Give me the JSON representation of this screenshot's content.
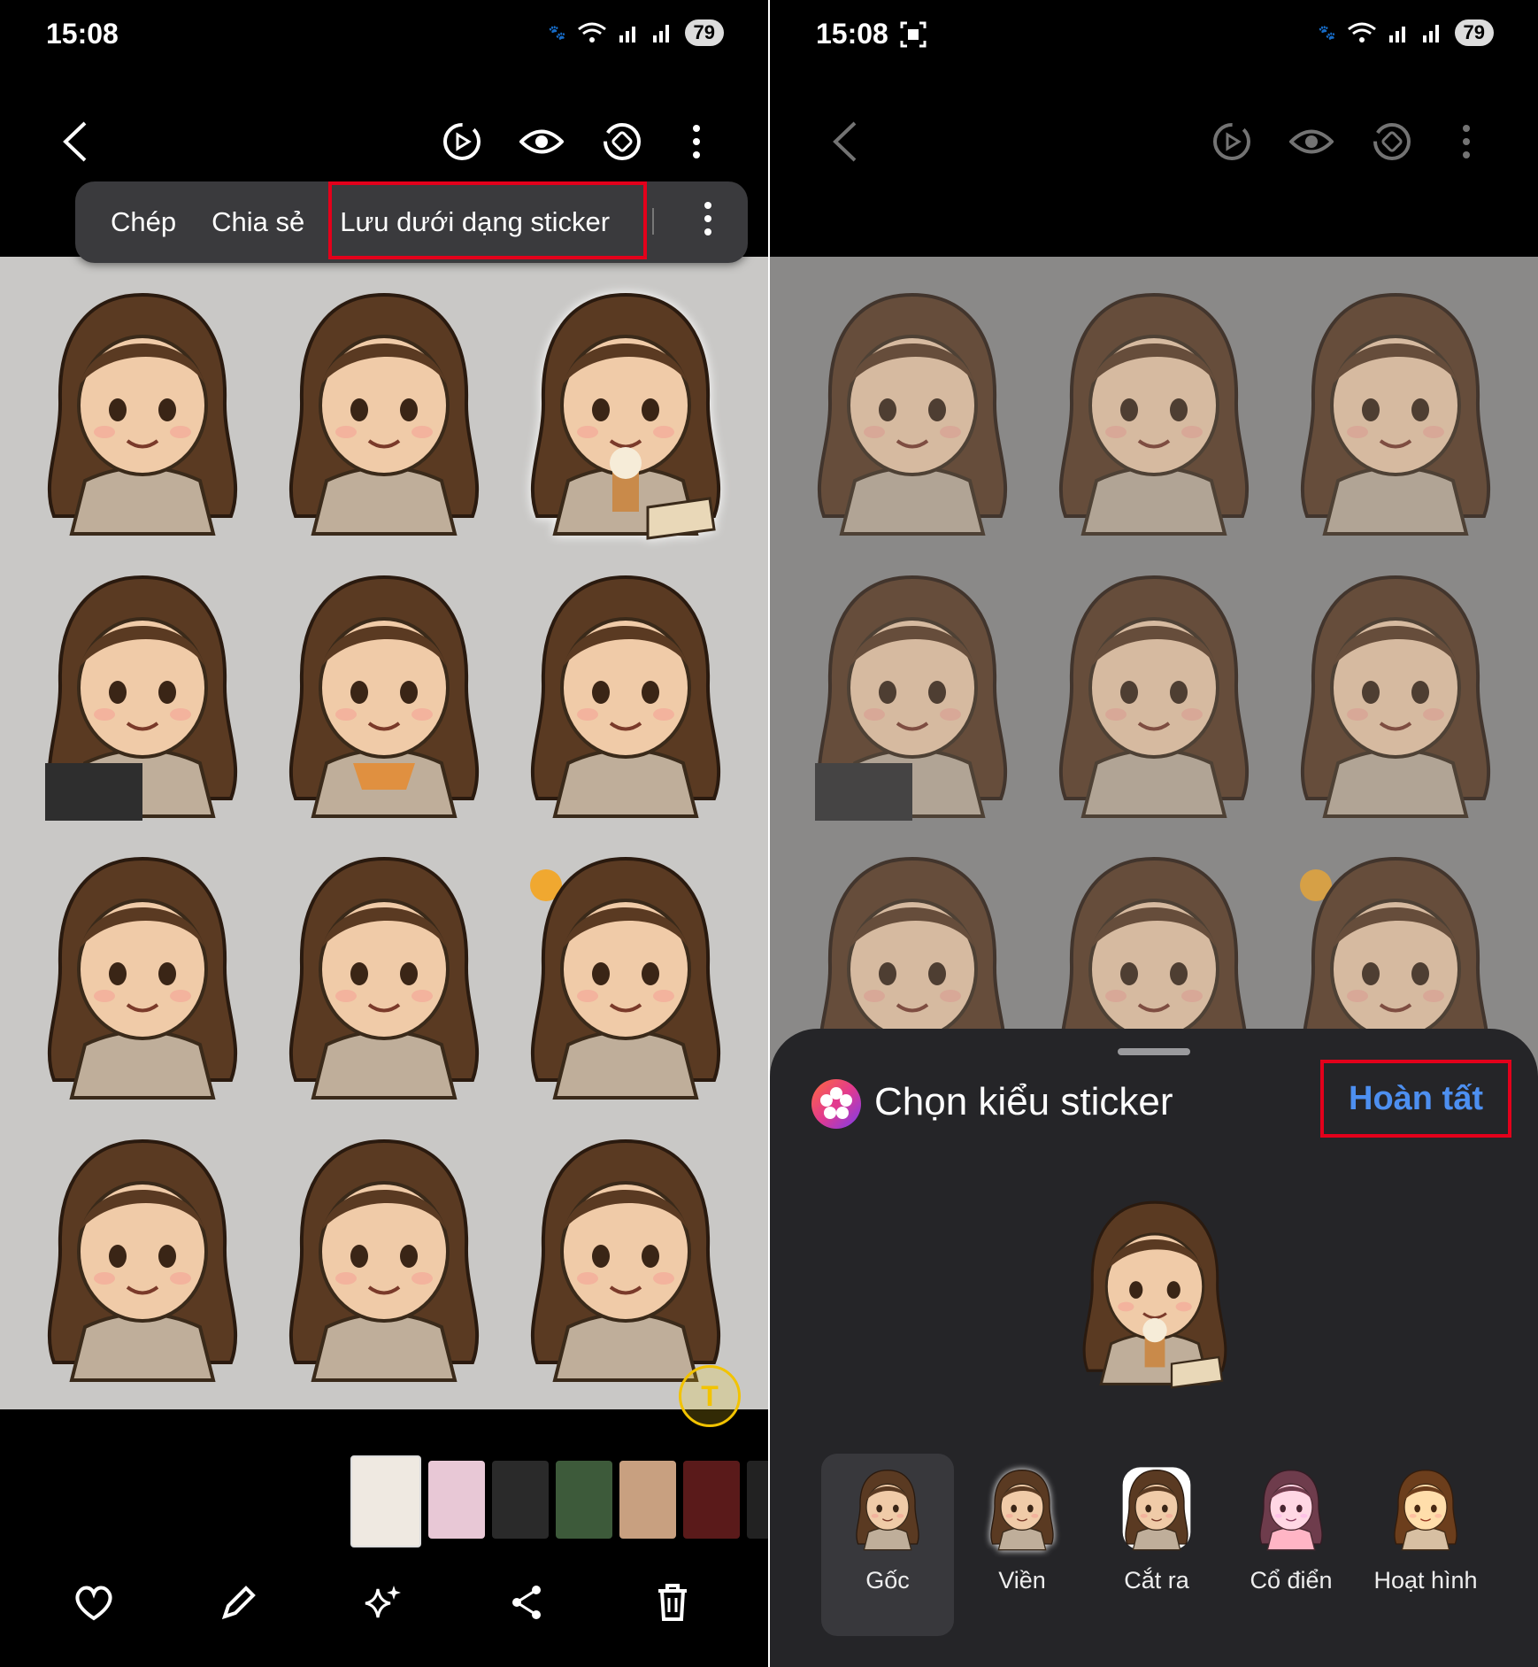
{
  "left": {
    "status": {
      "time": "15:08",
      "battery": "79"
    },
    "popup": {
      "items": [
        "Chép",
        "Chia sẻ",
        "Lưu dưới dạng sticker"
      ]
    }
  },
  "right": {
    "status": {
      "time": "15:08",
      "battery": "79"
    },
    "sheet": {
      "title": "Chọn kiểu sticker",
      "done_label": "Hoàn tất",
      "styles": [
        "Gốc",
        "Viền",
        "Cắt ra",
        "Cổ điển",
        "Hoạt hình"
      ],
      "selected_style": "Gốc"
    }
  },
  "colors": {
    "highlight_border": "#e3001b",
    "done_text": "#4d8ff0",
    "sheet_bg": "#252528",
    "image_bg": "#c9c8c6"
  },
  "icons": {
    "topbar": [
      "back-icon",
      "motion-photo-icon",
      "eye-icon",
      "remaster-icon",
      "more-vert-icon"
    ],
    "bottombar": [
      "heart-icon",
      "edit-pencil-icon",
      "sparkle-ai-icon",
      "share-icon",
      "trash-icon"
    ]
  }
}
